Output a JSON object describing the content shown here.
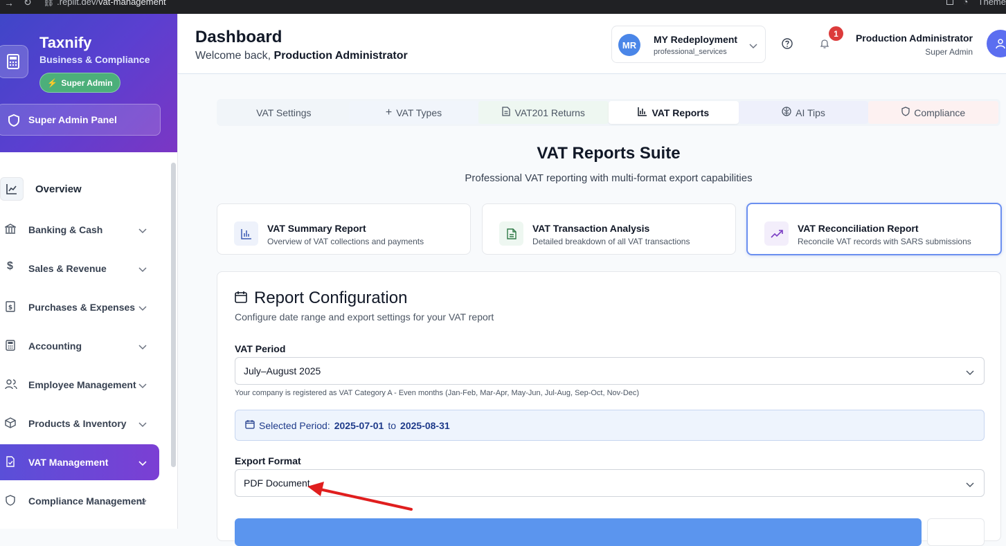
{
  "browser": {
    "url_prefix": ".replit.dev/",
    "url_path": "vat-management",
    "right_text": "Theme"
  },
  "sidebar": {
    "brand": "Taxnify",
    "brand_sub": "Business & Compliance",
    "role_pill": "Super Admin",
    "panel_button": "Super Admin Panel",
    "overview": "Overview",
    "items": [
      {
        "label": "Banking & Cash",
        "icon": "bank-icon"
      },
      {
        "label": "Sales & Revenue",
        "icon": "dollar-icon"
      },
      {
        "label": "Purchases & Expenses",
        "icon": "receipt-icon"
      },
      {
        "label": "Accounting",
        "icon": "calculator-icon"
      },
      {
        "label": "Employee Management",
        "icon": "users-icon"
      },
      {
        "label": "Products & Inventory",
        "icon": "box-icon"
      },
      {
        "label": "VAT Management",
        "icon": "file-check-icon"
      },
      {
        "label": "Compliance Management",
        "icon": "shield-icon"
      }
    ]
  },
  "header": {
    "title": "Dashboard",
    "welcome": "Welcome back,",
    "user_bold": "Production Administrator",
    "company_initials": "MR",
    "company_name": "MY Redeployment",
    "company_sub": "professional_services",
    "notif_count": "1",
    "user_name": "Production Administrator",
    "user_role": "Super Admin"
  },
  "tabs": [
    "VAT Settings",
    "VAT Types",
    "VAT201 Returns",
    "VAT Reports",
    "AI Tips",
    "Compliance"
  ],
  "suite": {
    "title": "VAT Reports Suite",
    "subtitle": "Professional VAT reporting with multi-format export capabilities"
  },
  "report_cards": [
    {
      "title": "VAT Summary Report",
      "desc": "Overview of VAT collections and payments"
    },
    {
      "title": "VAT Transaction Analysis",
      "desc": "Detailed breakdown of all VAT transactions"
    },
    {
      "title": "VAT Reconciliation Report",
      "desc": "Reconcile VAT records with SARS submissions"
    }
  ],
  "config": {
    "title": "Report Configuration",
    "subtitle": "Configure date range and export settings for your VAT report",
    "period_label": "VAT Period",
    "period_value": "July–August 2025",
    "hint": "Your company is registered as VAT Category A - Even months (Jan-Feb, Mar-Apr, May-Jun, Jul-Aug, Sep-Oct, Nov-Dec)",
    "selected_prefix": "Selected Period:",
    "start": "2025-07-01",
    "to": "to",
    "end": "2025-08-31",
    "export_label": "Export Format",
    "export_value": "PDF Document"
  },
  "colors": {
    "accent": "#5b3fd0",
    "primary_button": "#5b95ee",
    "annotation_arrow": "#e01e1e"
  }
}
